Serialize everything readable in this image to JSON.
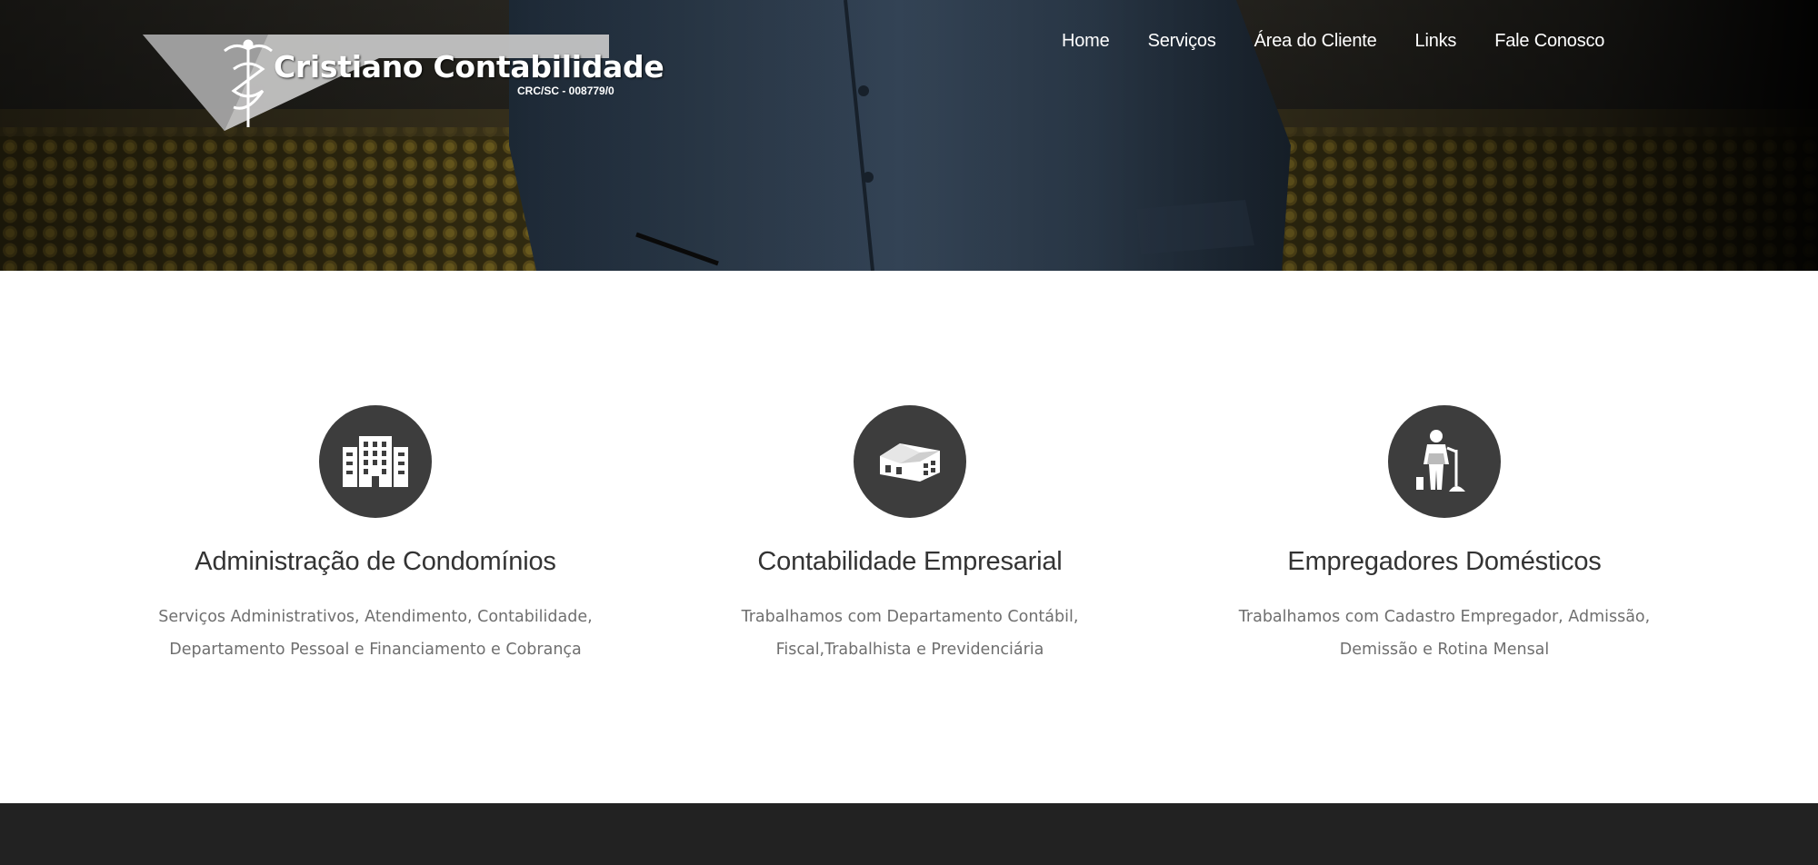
{
  "header": {
    "logo": {
      "name": "Cristiano Contabilidade",
      "registration": "CRC/SC - 008779/0"
    },
    "nav": [
      {
        "label": "Home"
      },
      {
        "label": "Serviços"
      },
      {
        "label": "Área do Cliente"
      },
      {
        "label": "Links"
      },
      {
        "label": "Fale Conosco"
      }
    ]
  },
  "services": [
    {
      "icon": "building-icon",
      "title": "Administração de Condomínios",
      "description_lines": [
        "Serviços Administrativos, Atendimento, Contabilidade,",
        "Departamento Pessoal e Financiamento e Cobrança"
      ]
    },
    {
      "icon": "warehouse-icon",
      "title": "Contabilidade Empresarial",
      "description_lines": [
        "Trabalhamos com Departamento Contábil,",
        "Fiscal,Trabalhista e Previdenciária"
      ]
    },
    {
      "icon": "housekeeper-icon",
      "title": "Empregadores Domésticos",
      "description_lines": [
        "Trabalhamos com Cadastro Empregador, Admissão,",
        "Demissão e Rotina Mensal"
      ]
    }
  ],
  "colors": {
    "icon_circle": "#3d3d3d",
    "title": "#333333",
    "description": "#6f6f6f",
    "footer": "#222222"
  }
}
